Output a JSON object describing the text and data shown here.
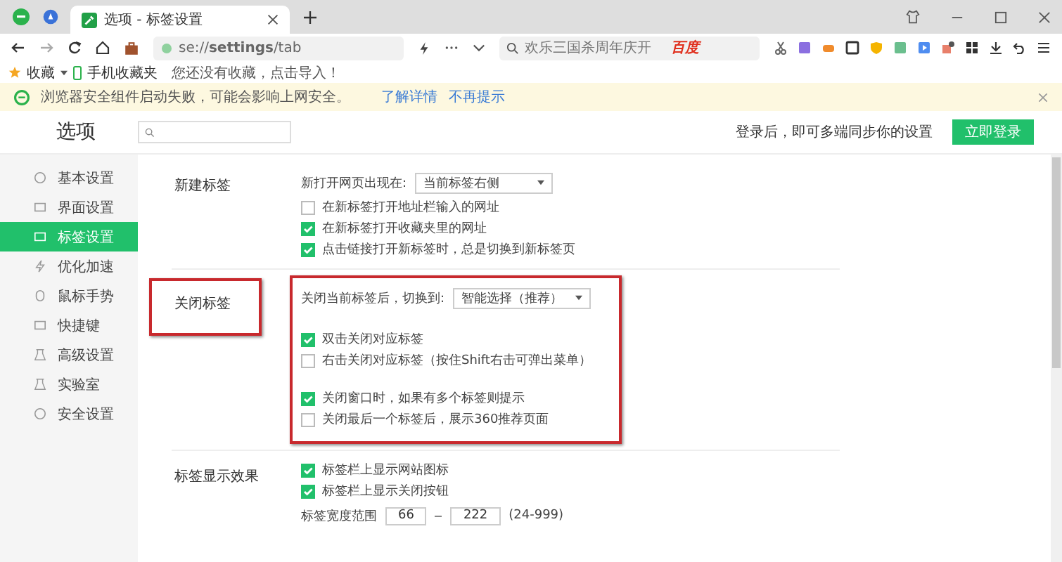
{
  "tabs": [
    {
      "title": "选项 - 标签设置",
      "selected": true
    }
  ],
  "address": {
    "url": "se://**settings**/tab",
    "search_placeholder": "欢乐三国杀周年庆开",
    "search_engine": "百度"
  },
  "bookmarks": {
    "items": [
      "收藏",
      "手机收藏夹"
    ],
    "hint": "您还没有收藏，点击导入！"
  },
  "notice": {
    "text": "浏览器安全组件启动失败，可能会影响上网安全。",
    "links": [
      "了解详情",
      "不再提示"
    ]
  },
  "header": {
    "title": "选项",
    "login_hint": "登录后，即可多端同步你的设置",
    "login_button": "立即登录"
  },
  "sidebar": {
    "items": [
      {
        "label": "基本设置",
        "selected": false
      },
      {
        "label": "界面设置",
        "selected": false
      },
      {
        "label": "标签设置",
        "selected": true
      },
      {
        "label": "优化加速",
        "selected": false
      },
      {
        "label": "鼠标手势",
        "selected": false
      },
      {
        "label": "快捷键",
        "selected": false
      },
      {
        "label": "高级设置",
        "selected": false
      },
      {
        "label": "实验室",
        "selected": false
      },
      {
        "label": "安全设置",
        "selected": false
      }
    ]
  },
  "sections": [
    {
      "title": "新建标签",
      "highlighted": false,
      "items": [
        {
          "kind": "select",
          "label": "新打开网页出现在:",
          "value": "当前标签右侧"
        },
        {
          "kind": "checkbox",
          "label": "在新标签打开地址栏输入的网址",
          "checked": false
        },
        {
          "kind": "checkbox",
          "label": "在新标签打开收藏夹里的网址",
          "checked": true
        },
        {
          "kind": "checkbox",
          "label": "点击链接打开新标签时，总是切换到新标签页",
          "checked": true
        }
      ]
    },
    {
      "title": "关闭标签",
      "highlighted": true,
      "items": [
        {
          "kind": "select",
          "label": "关闭当前标签后，切换到:",
          "value": "智能选择（推荐）"
        },
        {
          "kind": "gap"
        },
        {
          "kind": "checkbox",
          "label": "双击关闭对应标签",
          "checked": true
        },
        {
          "kind": "checkbox",
          "label": "右击关闭对应标签（按住Shift右击可弹出菜单）",
          "checked": false
        },
        {
          "kind": "gap"
        },
        {
          "kind": "checkbox",
          "label": "关闭窗口时，如果有多个标签则提示",
          "checked": true
        },
        {
          "kind": "checkbox",
          "label": "关闭最后一个标签后，展示360推荐页面",
          "checked": false
        }
      ]
    },
    {
      "title": "标签显示效果",
      "highlighted": false,
      "items": [
        {
          "kind": "checkbox",
          "label": "标签栏上显示网站图标",
          "checked": true
        },
        {
          "kind": "checkbox",
          "label": "标签栏上显示关闭按钮",
          "checked": true
        },
        {
          "kind": "range",
          "label": "标签宽度范围",
          "min": "66",
          "max": "222",
          "note": "(24-999)"
        }
      ]
    }
  ]
}
